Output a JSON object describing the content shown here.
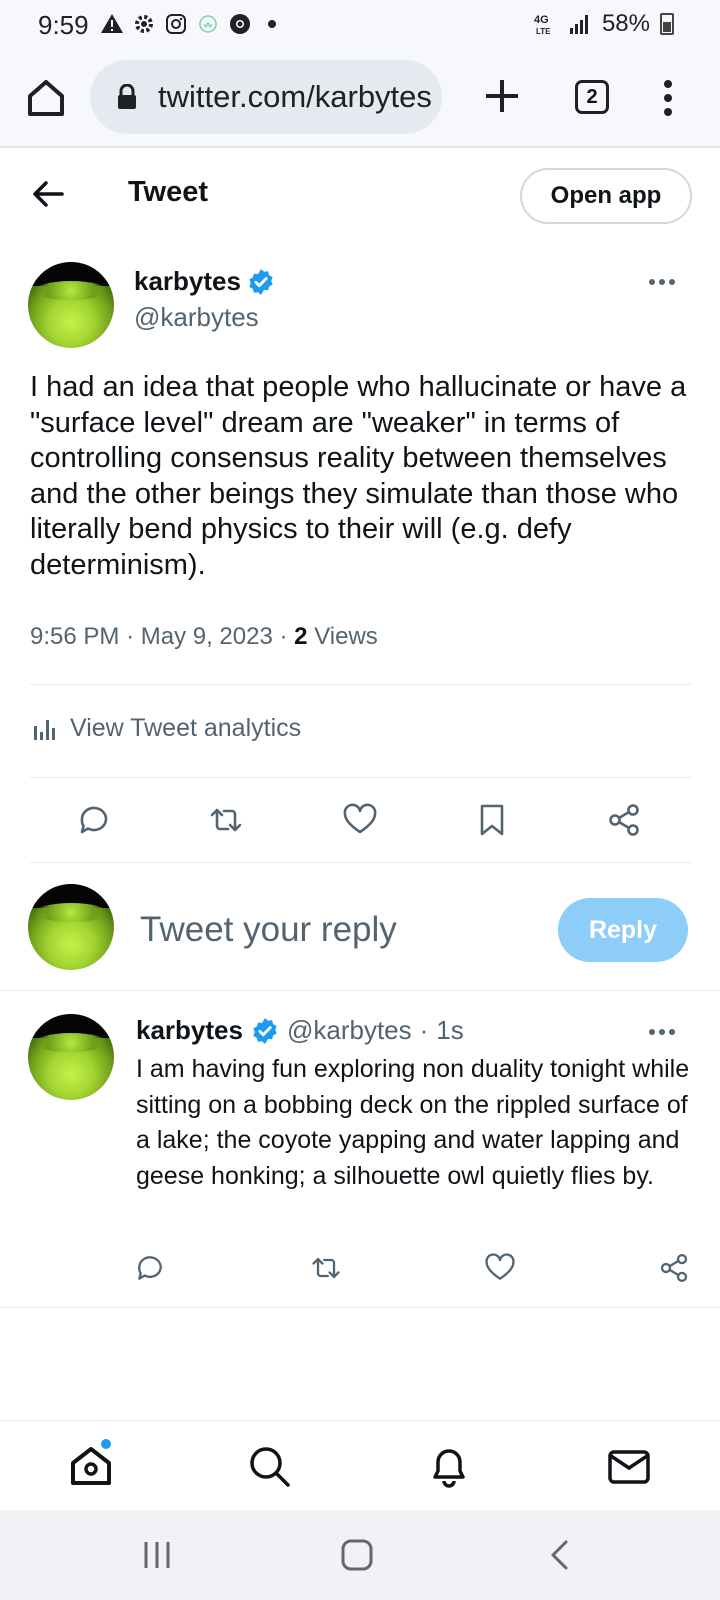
{
  "status_bar": {
    "time": "9:59",
    "network": "4G LTE",
    "battery": "58%"
  },
  "browser": {
    "url": "twitter.com/karbytes",
    "tab_count": "2"
  },
  "header": {
    "title": "Tweet",
    "open_app_label": "Open app"
  },
  "tweet": {
    "author_name": "karbytes",
    "author_handle": "@karbytes",
    "text": "I had an idea that people who hallucinate or have a \"surface level\" dream are \"weaker\" in terms of controlling consensus reality between themselves and the other beings they simulate than those who literally bend physics to their will (e.g. defy determinism).",
    "time": "9:56 PM",
    "date": "May 9, 2023",
    "views_count": "2",
    "views_label": "Views",
    "analytics_label": "View Tweet analytics"
  },
  "compose": {
    "placeholder": "Tweet your reply",
    "reply_label": "Reply"
  },
  "reply": {
    "author_name": "karbytes",
    "author_handle": "@karbytes",
    "age": "1s",
    "text": "I am having fun exploring non duality tonight while sitting on a bobbing deck on the rippled surface of a lake; the coyote yapping and water lapping and geese honking; a silhouette owl quietly flies by."
  },
  "colors": {
    "accent": "#1d9bf0",
    "reply_button": "#8ecdf8",
    "secondary_text": "#536471"
  },
  "icons": {
    "nav": [
      "home-icon",
      "search-icon",
      "bell-icon",
      "mail-icon"
    ],
    "actions": [
      "reply-icon",
      "retweet-icon",
      "like-icon",
      "bookmark-icon",
      "share-icon"
    ]
  }
}
